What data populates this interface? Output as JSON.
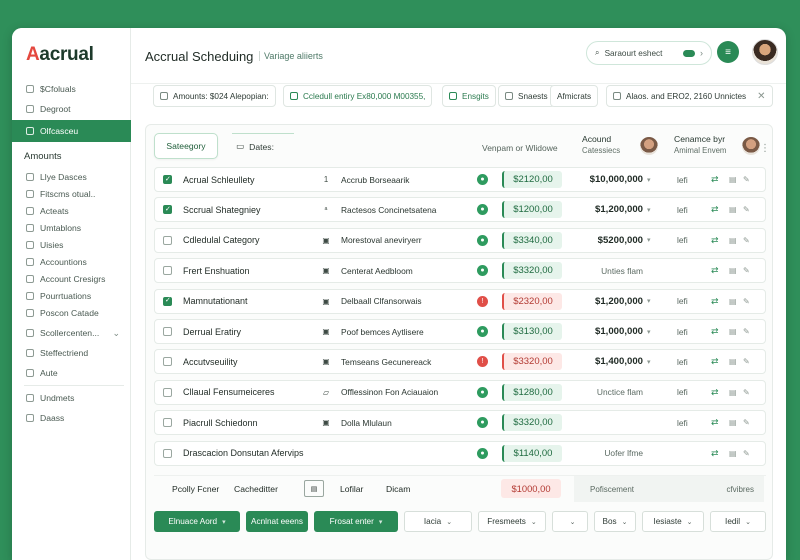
{
  "app": {
    "logo_accent": "A",
    "logo_rest": "acrual",
    "accent_color": "#2a8a56",
    "danger_color": "#e04f48"
  },
  "sidebar": {
    "top_items": [
      {
        "label": "$Cfoluals",
        "icon": "doc-icon"
      },
      {
        "label": "Degroot",
        "icon": "doc-icon"
      }
    ],
    "active_item": {
      "label": "Olfcasceu",
      "icon": "grid-icon"
    },
    "section_heading": "Amounts",
    "items": [
      {
        "label": "Llye Dasces"
      },
      {
        "label": "Fitscms otual.."
      },
      {
        "label": "Acteats"
      },
      {
        "label": "Umtablons"
      },
      {
        "label": "Uisies"
      },
      {
        "label": "Accountions"
      },
      {
        "label": "Account Cresigrs"
      },
      {
        "label": "Pourrtuations"
      },
      {
        "label": "Poscon Catade"
      },
      {
        "label": "Scollercenten..."
      },
      {
        "label": "Steffectriend"
      },
      {
        "label": "Aute"
      }
    ],
    "bottom_items": [
      {
        "label": "Undmets"
      },
      {
        "label": "Daass"
      }
    ]
  },
  "header": {
    "title": "Accrual Scheduing",
    "subtitle": "Variage aliierts",
    "search_label": "Saraourt eshect",
    "circle_button_icon": "menu-icon"
  },
  "filters": [
    {
      "label": "Amounts: $024 Alepopian:"
    },
    {
      "label": "Ccledull entiry Ex80,000 M00355,"
    },
    {
      "label": "Ensgits"
    },
    {
      "label": "Snaests"
    },
    {
      "label": "Afmicrats"
    },
    {
      "label": "Alaos. and ERO2, 2160 Unnictes"
    }
  ],
  "panel": {
    "tab_active": "Sateegory",
    "tab_inactive": "Dates:",
    "filter_label": "Venpam or Wlidowe",
    "col_account": {
      "title": "Acound",
      "sub": "Catessiecs"
    },
    "col_cename": {
      "title": "Cenamce byr",
      "sub": "Amimal Envem"
    }
  },
  "rows": [
    {
      "name": "Acrual Schleullety",
      "checked": true,
      "tag": "1",
      "desc": "Accrub Borseaarik",
      "status": "ok",
      "amount": "$2120,00",
      "amount_kind": "g",
      "total": "$10,000,000",
      "total_muted": false,
      "lf": "lefi"
    },
    {
      "name": "Sccrual Shategniey",
      "checked": true,
      "tag": "ᵃ",
      "desc": "Ractesos Concinetsatena",
      "status": "ok",
      "amount": "$1200,00",
      "amount_kind": "g",
      "total": "$1,200,000",
      "total_muted": false,
      "lf": "lefi"
    },
    {
      "name": "Cdledulal Category",
      "checked": false,
      "tag": "▣",
      "desc": "Morestoval aneviryerr",
      "status": "ok",
      "amount": "$3340,00",
      "amount_kind": "g",
      "total": "$5200,000",
      "total_muted": false,
      "lf": "lefi"
    },
    {
      "name": "Frert Enshuation",
      "checked": false,
      "tag": "▣",
      "desc": "Centerat Aedbloom",
      "status": "ok",
      "amount": "$3320,00",
      "amount_kind": "g",
      "total": "Unties flam",
      "total_muted": true,
      "lf": ""
    },
    {
      "name": "Mamnutationant",
      "checked": true,
      "tag": "▣",
      "desc": "Delbaall Clfansorwais",
      "status": "bad",
      "amount": "$2320,00",
      "amount_kind": "r",
      "total": "$1,200,000",
      "total_muted": false,
      "lf": "lefi"
    },
    {
      "name": "Derrual Eratiry",
      "checked": false,
      "tag": "▣",
      "desc": "Poof bemces Aytlisere",
      "status": "ok",
      "amount": "$3130,00",
      "amount_kind": "g",
      "total": "$1,000,000",
      "total_muted": false,
      "lf": "lefi"
    },
    {
      "name": "Accutvseuility",
      "checked": false,
      "tag": "▣",
      "desc": "Temseans Gecunereack",
      "status": "bad",
      "amount": "$3320,00",
      "amount_kind": "r",
      "total": "$1,400,000",
      "total_muted": false,
      "lf": "lefi"
    },
    {
      "name": "Cllaual Fensumeiceres",
      "checked": false,
      "tag": "▱",
      "desc": "Offlessinon Fon Aciauaion",
      "status": "ok",
      "amount": "$1280,00",
      "amount_kind": "g",
      "total": "Unctice flam",
      "total_muted": true,
      "lf": "lefi"
    },
    {
      "name": "Piacrull Schiedonn",
      "checked": false,
      "tag": "▣",
      "desc": "Dolla Mlulaun",
      "status": "ok",
      "amount": "$3320,00",
      "amount_kind": "g",
      "total": "",
      "total_muted": true,
      "lf": "lefi"
    },
    {
      "name": "Drascacion   Donsutan     Afervips",
      "checked": false,
      "tag": "",
      "desc": "",
      "status": "ok",
      "amount": "$1140,00",
      "amount_kind": "g",
      "total": "Uofer lfme",
      "total_muted": true,
      "lf": ""
    }
  ],
  "last_row": {
    "a": "Pcolly Fcner",
    "b": "Cacheditter",
    "c": "Lofilar",
    "d": "Dicam",
    "amount": "$1000,00",
    "grey_left": "Pofiscement",
    "grey_right": "cfvibres"
  },
  "bottom_bar": [
    {
      "label": "Elnuace Aord",
      "dark": true
    },
    {
      "label": "Acnlnat eeens",
      "dark": true
    },
    {
      "label": "Frosat enter",
      "dark": true
    },
    {
      "label": "Iacia",
      "dark": false
    },
    {
      "label": "Fresmeets",
      "dark": false
    },
    {
      "label": "",
      "dark": false
    },
    {
      "label": "Bos",
      "dark": false
    },
    {
      "label": "Iesiaste",
      "dark": false
    },
    {
      "label": "Iedil",
      "dark": false
    }
  ]
}
